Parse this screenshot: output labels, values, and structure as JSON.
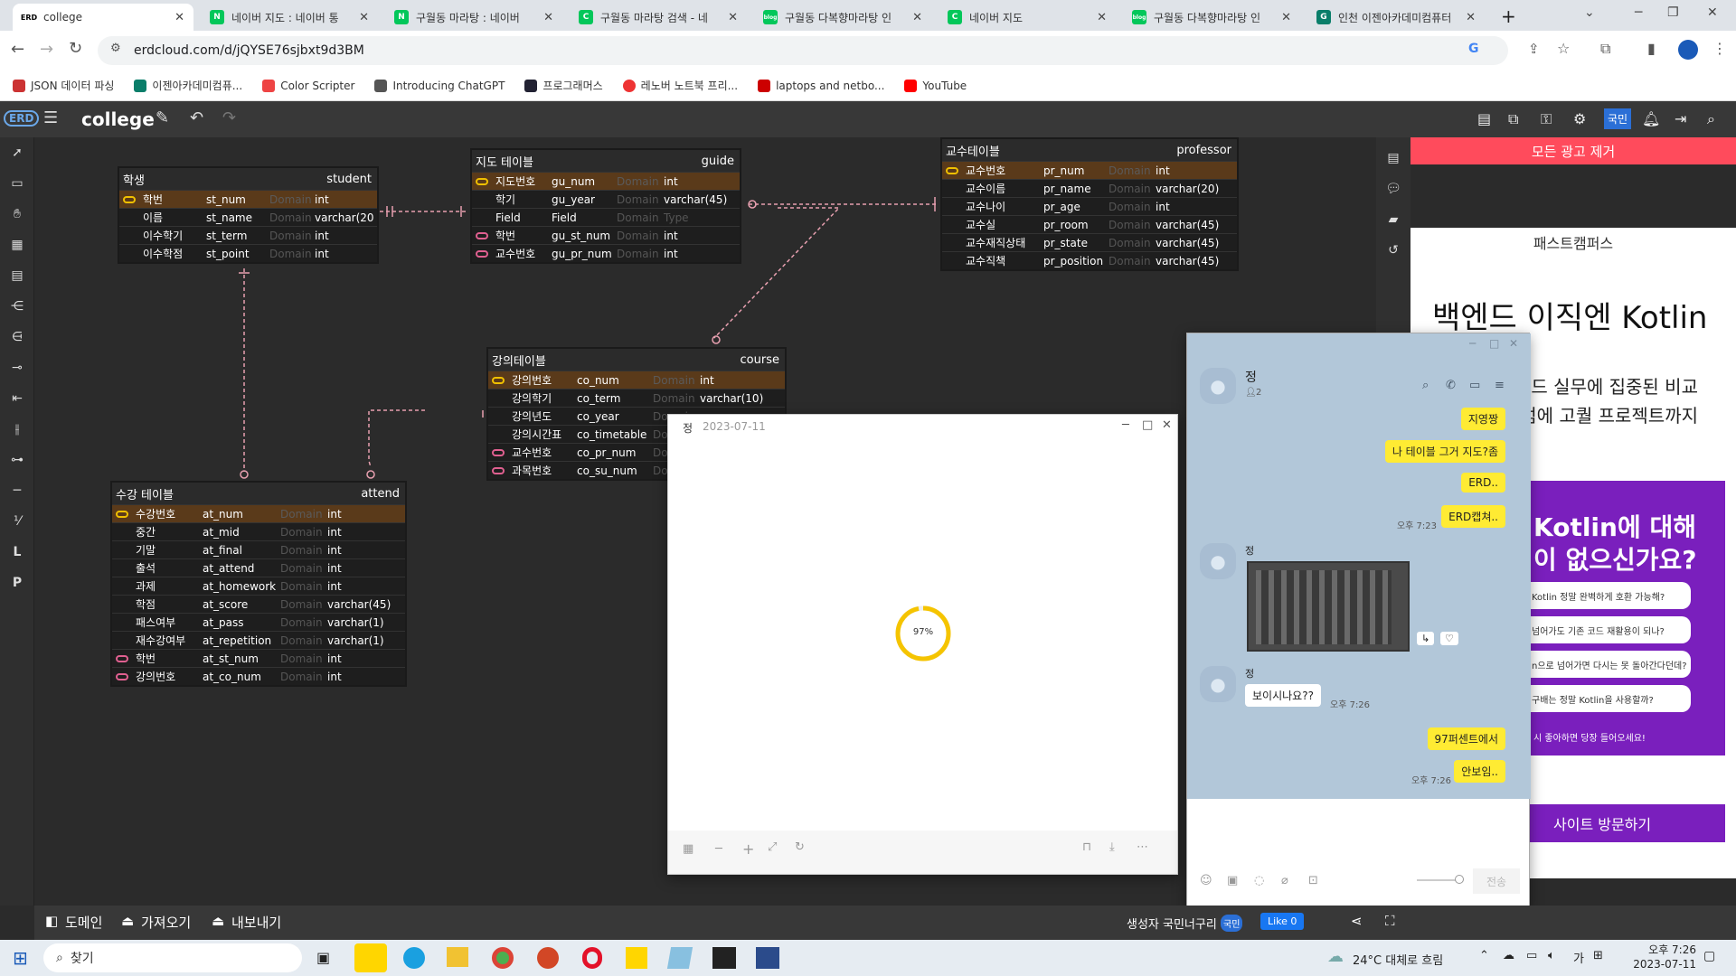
{
  "browser": {
    "tabs": [
      {
        "label": "college",
        "fav": "ERD",
        "color": "#fff"
      },
      {
        "label": "네이버 지도 : 네이버 통",
        "fav": "N",
        "color": "#03c75a"
      },
      {
        "label": "구월동 마라탕 : 네이버",
        "fav": "N",
        "color": "#03c75a"
      },
      {
        "label": "구월동 마라탕 검색 - 네",
        "fav": "C",
        "color": "#03c75a"
      },
      {
        "label": "구월동 다복향마라탕 인",
        "fav": "blog",
        "color": "#03c75a"
      },
      {
        "label": "네이버 지도",
        "fav": "C",
        "color": "#03c75a"
      },
      {
        "label": "구월동 다복향마라탕 인",
        "fav": "blog",
        "color": "#03c75a"
      },
      {
        "label": "인천 이젠아카데미컴퓨터",
        "fav": "G",
        "color": "#0a7e6a"
      }
    ],
    "new_tab": "+",
    "url": "erdcloud.com/d/jQYSE76sjbxt9d3BM",
    "bookmarks": [
      {
        "label": "JSON 데이터 파싱",
        "color": "#c33"
      },
      {
        "label": "이젠아카데미컴퓨...",
        "color": "#0a7e6a"
      },
      {
        "label": "Color Scripter",
        "color": "#e44"
      },
      {
        "label": "Introducing ChatGPT",
        "color": "#555"
      },
      {
        "label": "프로그래머스",
        "color": "#223"
      },
      {
        "label": "레노버 노트북 프리...",
        "color": "#e33"
      },
      {
        "label": "laptops and netbo...",
        "color": "#c00"
      },
      {
        "label": "YouTube",
        "color": "#f00"
      }
    ]
  },
  "erd": {
    "title": "college",
    "user_badge": "국민",
    "ad_remove": "모든 광고 제거",
    "footer": {
      "domain": "도메인",
      "import": "가져오기",
      "export": "내보내기",
      "creator": "생성자 국민너구리",
      "creator_badge": "국민",
      "like": "Like 0"
    },
    "tables": [
      {
        "id": "student",
        "kname": "학생",
        "ename": "student",
        "rows": [
          [
            "pk",
            "학번",
            "st_num",
            "Domain",
            "int"
          ],
          [
            "",
            "이름",
            "st_name",
            "Domain",
            "varchar(20)"
          ],
          [
            "",
            "이수학기",
            "st_term",
            "Domain",
            "int"
          ],
          [
            "",
            "이수학점",
            "st_point",
            "Domain",
            "int"
          ]
        ]
      },
      {
        "id": "guide",
        "kname": "지도 테이블",
        "ename": "guide",
        "rows": [
          [
            "pk",
            "지도번호",
            "gu_num",
            "Domain",
            "int"
          ],
          [
            "",
            "학기",
            "gu_year",
            "Domain",
            "varchar(45)"
          ],
          [
            "",
            "Field",
            "Field",
            "Domain",
            "Type"
          ],
          [
            "fk",
            "학번",
            "gu_st_num",
            "Domain",
            "int"
          ],
          [
            "fk",
            "교수번호",
            "gu_pr_num",
            "Domain",
            "int"
          ]
        ]
      },
      {
        "id": "professor",
        "kname": "교수테이블",
        "ename": "professor",
        "rows": [
          [
            "pk",
            "교수번호",
            "pr_num",
            "Domain",
            "int"
          ],
          [
            "",
            "교수이름",
            "pr_name",
            "Domain",
            "varchar(20)"
          ],
          [
            "",
            "교수나이",
            "pr_age",
            "Domain",
            "int"
          ],
          [
            "",
            "교수실",
            "pr_room",
            "Domain",
            "varchar(45)"
          ],
          [
            "",
            "교수재직상태",
            "pr_state",
            "Domain",
            "varchar(45)"
          ],
          [
            "",
            "교수직책",
            "pr_position",
            "Domain",
            "varchar(45)"
          ]
        ]
      },
      {
        "id": "course",
        "kname": "강의테이블",
        "ename": "course",
        "rows": [
          [
            "pk",
            "강의번호",
            "co_num",
            "Domain",
            "int"
          ],
          [
            "",
            "강의학기",
            "co_term",
            "Domain",
            "varchar(10)"
          ],
          [
            "",
            "강의년도",
            "co_year",
            "Domain",
            ""
          ],
          [
            "",
            "강의시간표",
            "co_timetable",
            "Domain",
            ""
          ],
          [
            "fk",
            "교수번호",
            "co_pr_num",
            "Domain",
            ""
          ],
          [
            "fk",
            "과목번호",
            "co_su_num",
            "Domain",
            ""
          ]
        ]
      },
      {
        "id": "attend",
        "kname": "수강 테이블",
        "ename": "attend",
        "rows": [
          [
            "pk",
            "수강번호",
            "at_num",
            "Domain",
            "int"
          ],
          [
            "",
            "중간",
            "at_mid",
            "Domain",
            "int"
          ],
          [
            "",
            "기말",
            "at_final",
            "Domain",
            "int"
          ],
          [
            "",
            "출석",
            "at_attend",
            "Domain",
            "int"
          ],
          [
            "",
            "과제",
            "at_homework",
            "Domain",
            "int"
          ],
          [
            "",
            "학점",
            "at_score",
            "Domain",
            "varchar(45)"
          ],
          [
            "",
            "패스여부",
            "at_pass",
            "Domain",
            "varchar(1)"
          ],
          [
            "",
            "재수강여부",
            "at_repetition",
            "Domain",
            "varchar(1)"
          ],
          [
            "fk",
            "학번",
            "at_st_num",
            "Domain",
            "int"
          ],
          [
            "fk",
            "강의번호",
            "at_co_num",
            "Domain",
            "int"
          ]
        ]
      }
    ]
  },
  "ad": {
    "brand": "패스트캠퍼스",
    "headline": "백엔드 이직엔 Kotlin",
    "sub1": "드 실무에 집중된 비교",
    "sub2": "럼에 고퀄 프로젝트까지",
    "banner_title": "Kotlin에 대해",
    "banner_title2": "이 없으신가요?",
    "q1": "Kotlin 정말 완벽하게 호환 가능해?",
    "q2": "넘어가도 기존 코드 재활용이 되나?",
    "q3": "n으로 넘어가면 다시는 못 돌아간다던데?",
    "q4": "구배는 정말 Kotlin을 사용할까?",
    "banner_foot": "시 좋아하면 당장 들어오세요!",
    "visit": "사이트 방문하기"
  },
  "viewer": {
    "sender": "정",
    "date": "2023-07-11",
    "progress_label": "97%",
    "progress": 0.97
  },
  "chat": {
    "name": "정",
    "members": "2",
    "messages": [
      {
        "text": "지영짱"
      },
      {
        "text": "나 테이블 그거 지도?좀"
      },
      {
        "text": "ERD.."
      },
      {
        "text": "ERD캡쳐..",
        "time": "오후 7:23"
      },
      {
        "sender": "정"
      },
      {
        "sender": "정",
        "text": "보이시나요??",
        "time": "오후 7:26"
      },
      {
        "text": "97퍼센트에서"
      },
      {
        "text": "안보임..",
        "time": "오후 7:26"
      }
    ],
    "send": "전송"
  },
  "taskbar": {
    "search": "찾기",
    "weather": "24°C 대체로 흐림",
    "ime": "가",
    "time": "오후 7:26",
    "date": "2023-07-11"
  }
}
